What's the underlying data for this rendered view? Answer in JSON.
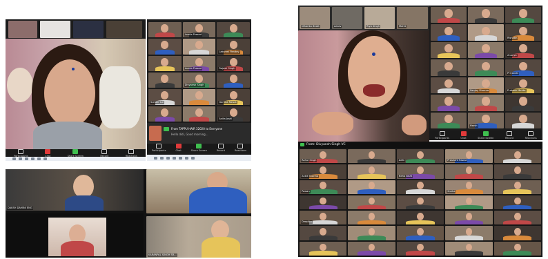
{
  "left": {
    "main": {
      "toolbar": [
        "Participants",
        "Chat",
        "Share Screen",
        "Record",
        "Reactions"
      ]
    },
    "gallery": {
      "tiles": [
        "",
        "Lamia Prasad",
        "",
        "",
        "",
        "Lakshmi Pandey",
        "",
        "Lamia Prasad",
        "Rajesh Singh",
        "",
        "Divyansh Singh",
        "",
        "Sunder Lal",
        "",
        "Garima Rawat",
        "",
        "",
        "Anita Joshi"
      ],
      "chat_notice_title": "From TAPPU HAIR 32020 to Everyone",
      "chat_notice_body": "Hello didi, Good morning...",
      "toolbar": [
        "Participants",
        "Chat",
        "Share Screen",
        "Record",
        "Reactions"
      ]
    },
    "bottom": {
      "tiles": [
        "DAKSH DAMINI ENG",
        "",
        "KARANPAL SINGH SR...",
        ""
      ]
    }
  },
  "right": {
    "main": {
      "top_names": [
        "Niharika Bhatt",
        "Aarav",
        "Riya Singh",
        "Mohit"
      ],
      "banner": "From: Divyansh Singh VC"
    },
    "gallery": {
      "tiles": [
        "",
        "",
        "",
        "",
        "",
        "Rishabh",
        "",
        "",
        "Ananya",
        "",
        "",
        "Priyanshi",
        "",
        "Sanjay Sharma",
        "Prakash Mehta",
        "",
        "",
        "",
        "",
        "Harsh",
        ""
      ],
      "toolbar": [
        "Participants",
        "Chat",
        "Share Screen",
        "Record",
        "Reactions"
      ]
    },
    "bottom": {
      "tiles": [
        "Rahul Singh",
        "",
        "Aditi",
        "Prashant Rawat",
        "",
        "Ankit Sharma",
        "",
        "Neha Bisht",
        "",
        "",
        "Pawan",
        "",
        "",
        "Sneha",
        "",
        "",
        "",
        "",
        "",
        "",
        "Deepika",
        "",
        "",
        "",
        "",
        "",
        "",
        "",
        "",
        "",
        "",
        "",
        "",
        "",
        ""
      ]
    }
  },
  "colors": {
    "zoom_dark": "#1c1c1c",
    "share_green": "#3fbf4f",
    "record_red": "#e03a3a"
  }
}
